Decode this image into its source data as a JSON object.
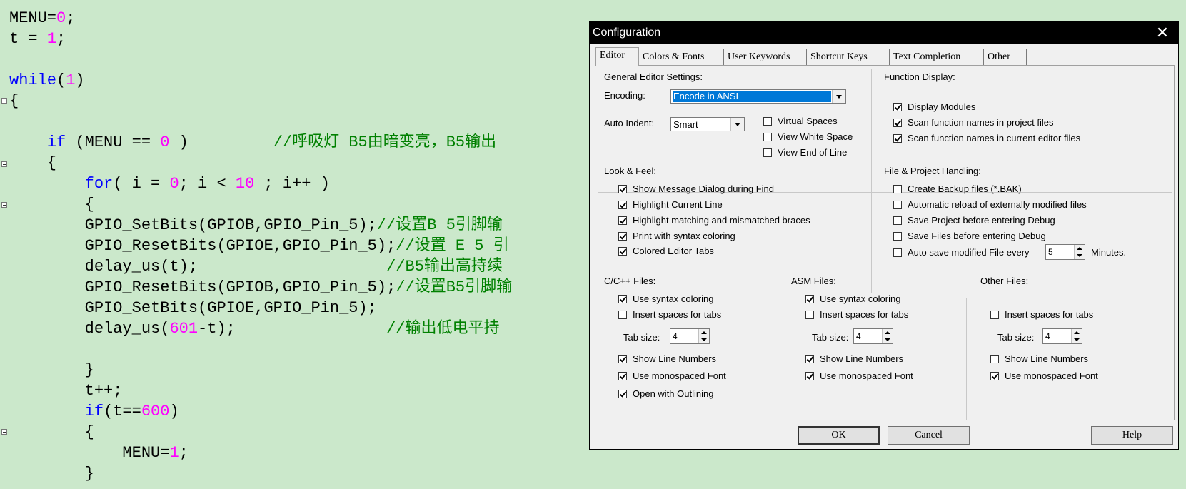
{
  "editor": {
    "lines": [
      [
        {
          "t": "MENU=",
          "c": ""
        },
        {
          "t": "0",
          "c": "num"
        },
        {
          "t": ";",
          "c": ""
        }
      ],
      [
        {
          "t": "t = ",
          "c": ""
        },
        {
          "t": "1",
          "c": "num"
        },
        {
          "t": ";",
          "c": ""
        }
      ],
      [],
      [
        {
          "t": "while",
          "c": "kw"
        },
        {
          "t": "(",
          "c": ""
        },
        {
          "t": "1",
          "c": "num"
        },
        {
          "t": ")",
          "c": ""
        }
      ],
      [
        {
          "t": "{",
          "c": ""
        }
      ],
      [],
      [
        {
          "t": "    ",
          "c": ""
        },
        {
          "t": "if",
          "c": "kw"
        },
        {
          "t": " (MENU == ",
          "c": ""
        },
        {
          "t": "0",
          "c": "num"
        },
        {
          "t": " )         ",
          "c": ""
        },
        {
          "t": "//呼吸灯 B5由暗变亮，B5输出",
          "c": "cmt"
        }
      ],
      [
        {
          "t": "    {",
          "c": ""
        }
      ],
      [
        {
          "t": "        ",
          "c": ""
        },
        {
          "t": "for",
          "c": "kw"
        },
        {
          "t": "( i = ",
          "c": ""
        },
        {
          "t": "0",
          "c": "num"
        },
        {
          "t": "; i < ",
          "c": ""
        },
        {
          "t": "10",
          "c": "num"
        },
        {
          "t": " ; i++ )",
          "c": ""
        }
      ],
      [
        {
          "t": "        {",
          "c": ""
        }
      ],
      [
        {
          "t": "        GPIO_SetBits(GPIOB,GPIO_Pin_5);",
          "c": ""
        },
        {
          "t": "//设置B 5引脚输",
          "c": "cmt"
        }
      ],
      [
        {
          "t": "        GPIO_ResetBits(GPIOE,GPIO_Pin_5);",
          "c": ""
        },
        {
          "t": "//设置 E 5 引",
          "c": "cmt"
        }
      ],
      [
        {
          "t": "        delay_us(t);                    ",
          "c": ""
        },
        {
          "t": "//B5输出高持续",
          "c": "cmt"
        }
      ],
      [
        {
          "t": "        GPIO_ResetBits(GPIOB,GPIO_Pin_5);",
          "c": ""
        },
        {
          "t": "//设置B5引脚输",
          "c": "cmt"
        }
      ],
      [
        {
          "t": "        GPIO_SetBits(GPIOE,GPIO_Pin_5);",
          "c": ""
        }
      ],
      [
        {
          "t": "        delay_us(",
          "c": ""
        },
        {
          "t": "601",
          "c": "num"
        },
        {
          "t": "-t);                ",
          "c": ""
        },
        {
          "t": "//输出低电平持",
          "c": "cmt"
        }
      ],
      [],
      [
        {
          "t": "        }",
          "c": ""
        }
      ],
      [
        {
          "t": "        t++;",
          "c": ""
        }
      ],
      [
        {
          "t": "        ",
          "c": ""
        },
        {
          "t": "if",
          "c": "kw"
        },
        {
          "t": "(t==",
          "c": ""
        },
        {
          "t": "600",
          "c": "num"
        },
        {
          "t": ")",
          "c": ""
        }
      ],
      [
        {
          "t": "        {",
          "c": ""
        }
      ],
      [
        {
          "t": "            MENU=",
          "c": ""
        },
        {
          "t": "1",
          "c": "num"
        },
        {
          "t": ";",
          "c": ""
        }
      ],
      [
        {
          "t": "        }",
          "c": ""
        }
      ]
    ]
  },
  "dialog": {
    "title": "Configuration",
    "close": "✕",
    "tabs": [
      "Editor",
      "Colors & Fonts",
      "User Keywords",
      "Shortcut Keys",
      "Text Completion",
      "Other"
    ],
    "general": {
      "label": "General Editor Settings:",
      "encoding_label": "Encoding:",
      "encoding_value": "Encode in ANSI",
      "indent_label": "Auto Indent:",
      "indent_value": "Smart",
      "virtual_spaces": "Virtual Spaces",
      "view_white_space": "View White Space",
      "view_end_of_line": "View End of Line"
    },
    "function_display": {
      "label": "Function Display:",
      "display_modules": "Display Modules",
      "scan_project": "Scan function names in project files",
      "scan_editor": "Scan function names in current editor files"
    },
    "look_feel": {
      "label": "Look & Feel:",
      "items": [
        "Show Message Dialog during Find",
        "Highlight Current Line",
        "Highlight matching and mismatched braces",
        "Print with syntax coloring",
        "Colored Editor Tabs"
      ]
    },
    "file_project": {
      "label": "File & Project Handling:",
      "items": [
        "Create Backup files (*.BAK)",
        "Automatic reload of externally modified files",
        "Save Project before entering Debug",
        "Save Files before entering Debug",
        "Auto save modified File every"
      ],
      "autosave_value": "5",
      "minutes": "Minutes."
    },
    "cpp": {
      "label": "C/C++ Files:",
      "syntax": "Use syntax coloring",
      "spaces": "Insert spaces for tabs",
      "tab_size_label": "Tab size:",
      "tab_size": "4",
      "line_numbers": "Show Line Numbers",
      "monospaced": "Use monospaced Font",
      "outlining": "Open with Outlining"
    },
    "asm": {
      "label": "ASM Files:",
      "syntax": "Use syntax coloring",
      "spaces": "Insert spaces for tabs",
      "tab_size_label": "Tab size:",
      "tab_size": "4",
      "line_numbers": "Show Line Numbers",
      "monospaced": "Use monospaced Font"
    },
    "other": {
      "label": "Other Files:",
      "spaces": "Insert spaces for tabs",
      "tab_size_label": "Tab size:",
      "tab_size": "4",
      "line_numbers": "Show Line Numbers",
      "monospaced": "Use monospaced Font"
    },
    "buttons": {
      "ok": "OK",
      "cancel": "Cancel",
      "help": "Help"
    }
  }
}
